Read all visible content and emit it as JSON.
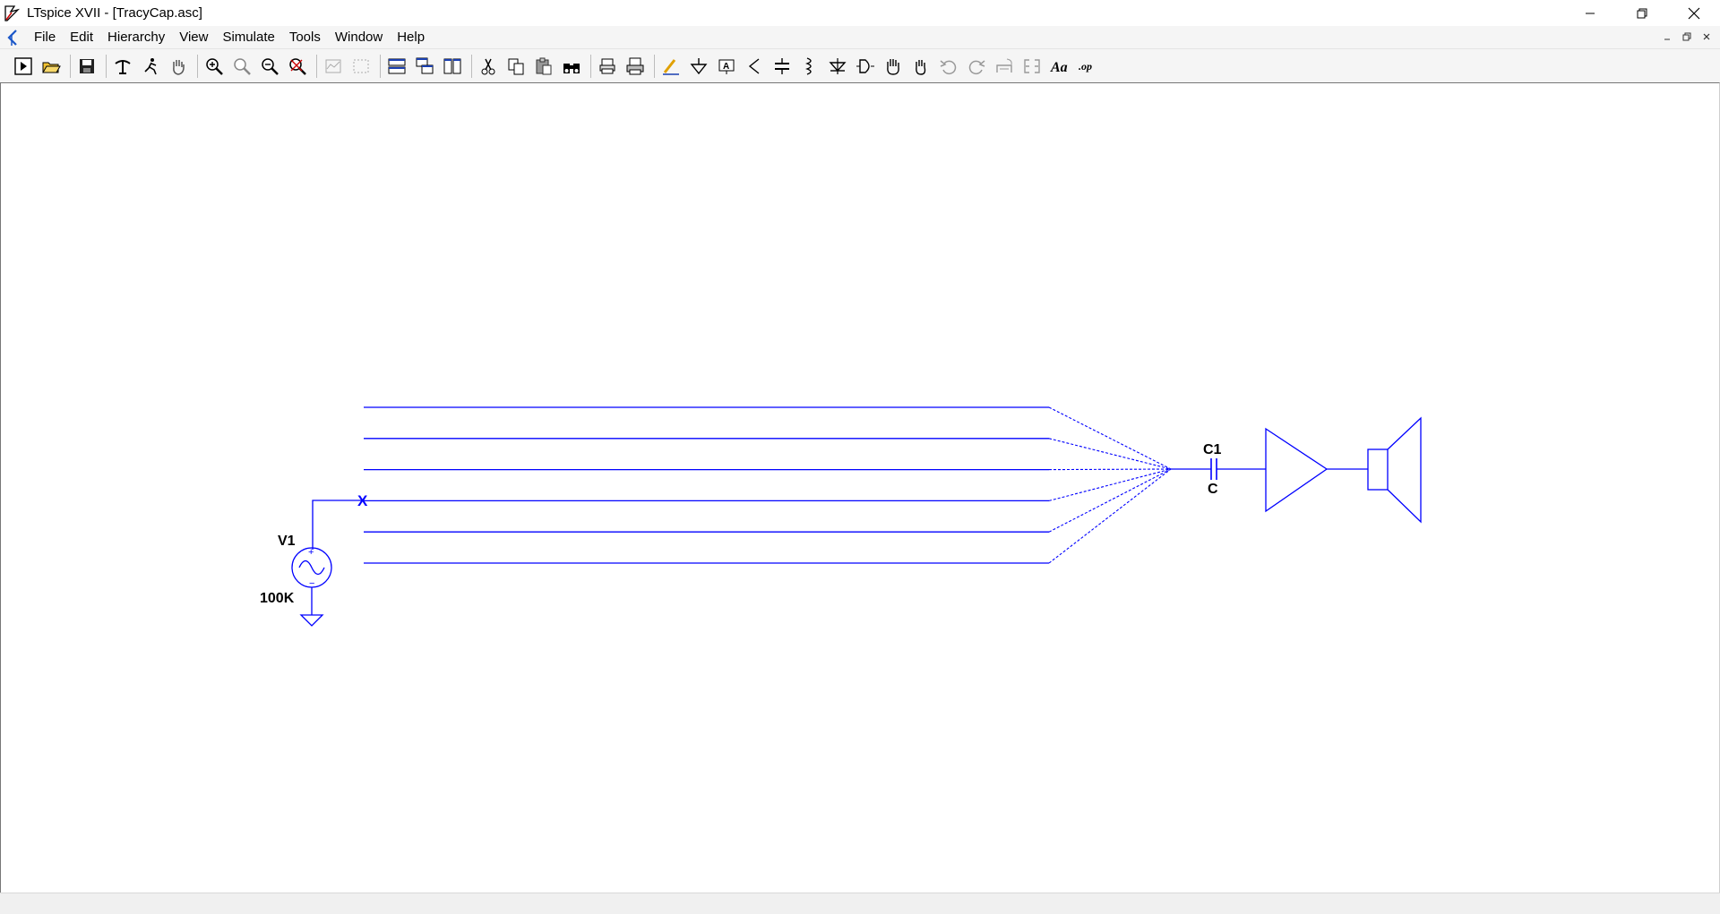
{
  "window": {
    "title": "LTspice XVII - [TracyCap.asc]"
  },
  "menu": {
    "items": [
      {
        "label": "File"
      },
      {
        "label": "Edit"
      },
      {
        "label": "Hierarchy"
      },
      {
        "label": "View"
      },
      {
        "label": "Simulate"
      },
      {
        "label": "Tools"
      },
      {
        "label": "Window"
      },
      {
        "label": "Help"
      }
    ]
  },
  "toolbar": {
    "buttons": [
      {
        "icon": "run-icon"
      },
      {
        "icon": "open-icon"
      },
      {
        "icon": "save-icon"
      },
      {
        "icon": "control-panel-icon"
      },
      {
        "icon": "halt-icon"
      },
      {
        "icon": "pan-hand-icon"
      },
      {
        "icon": "zoom-in-icon"
      },
      {
        "icon": "zoom-fit-icon"
      },
      {
        "icon": "zoom-out-icon"
      },
      {
        "icon": "zoom-cancel-icon"
      },
      {
        "icon": "autorange-icon"
      },
      {
        "icon": "mark-icon"
      },
      {
        "icon": "tile-horizontal-icon"
      },
      {
        "icon": "cascade-icon"
      },
      {
        "icon": "tile-vertical-icon"
      },
      {
        "icon": "cut-icon"
      },
      {
        "icon": "copy-icon"
      },
      {
        "icon": "paste-icon"
      },
      {
        "icon": "find-icon"
      },
      {
        "icon": "print-setup-icon"
      },
      {
        "icon": "print-icon"
      },
      {
        "icon": "wire-icon"
      },
      {
        "icon": "ground-icon"
      },
      {
        "icon": "label-net-icon"
      },
      {
        "icon": "resistor-icon"
      },
      {
        "icon": "capacitor-icon"
      },
      {
        "icon": "inductor-icon"
      },
      {
        "icon": "diode-icon"
      },
      {
        "icon": "component-icon"
      },
      {
        "icon": "move-icon"
      },
      {
        "icon": "drag-icon"
      },
      {
        "icon": "undo-icon"
      },
      {
        "icon": "redo-icon"
      },
      {
        "icon": "rotate-icon"
      },
      {
        "icon": "mirror-icon"
      },
      {
        "icon": "text-icon"
      },
      {
        "icon": "spice-directive-icon"
      }
    ]
  },
  "schematic": {
    "source_name": "V1",
    "source_value": "100K",
    "no_connect_mark": "X",
    "capacitor_name": "C1",
    "capacitor_value": "C",
    "wire_color": "#0000ff",
    "wire_count": 6
  }
}
